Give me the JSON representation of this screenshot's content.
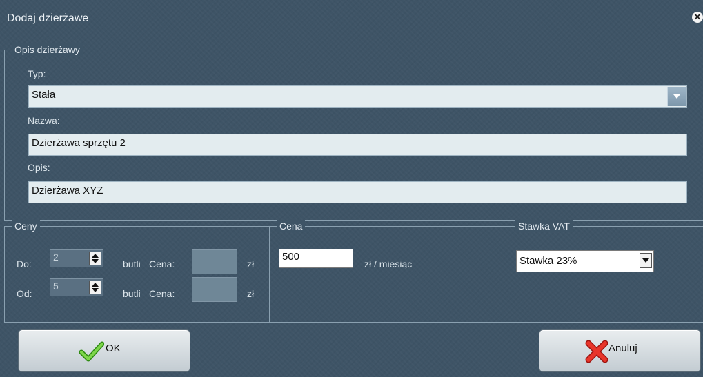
{
  "window": {
    "title": "Dodaj dzierżawe"
  },
  "description_group": {
    "title": "Opis dzierżawy",
    "type_label": "Typ:",
    "type_value": "Stała",
    "name_label": "Nazwa:",
    "name_value": "Dzierżawa sprzętu 2",
    "desc_label": "Opis:",
    "desc_value": "Dzierżawa XYZ"
  },
  "prices_group": {
    "title": "Ceny",
    "rows": [
      {
        "prefix": "Do:",
        "quantity": "2",
        "unit": "butli",
        "price_label": "Cena:",
        "currency": "zł"
      },
      {
        "prefix": "Od:",
        "quantity": "5",
        "unit": "butli",
        "price_label": "Cena:",
        "currency": "zł"
      }
    ]
  },
  "price_group": {
    "title": "Cena",
    "value": "500",
    "unit": "zł / miesiąc"
  },
  "vat_group": {
    "title": "Stawka VAT",
    "selected": "Stawka 23%"
  },
  "buttons": {
    "ok_label": "OK",
    "cancel_label": "Anuluj"
  },
  "colors": {
    "background": "#3e5466",
    "field": "#e3ecef",
    "ok_check": "#5cbf2a",
    "cancel_x": "#e0261b"
  }
}
